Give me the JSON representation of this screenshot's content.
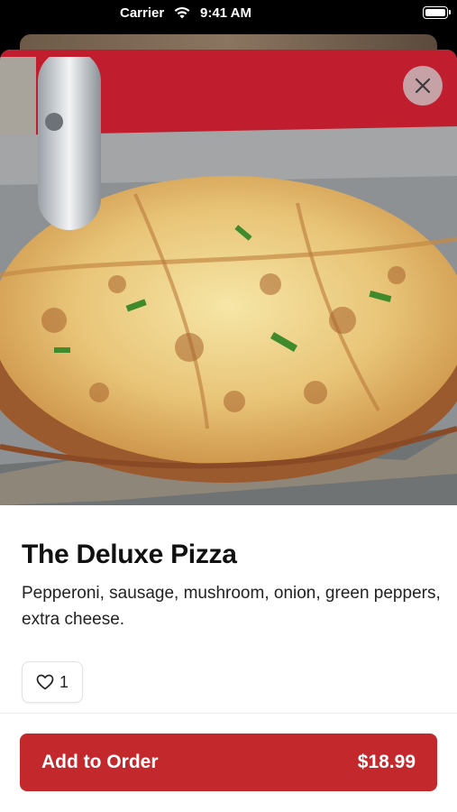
{
  "status_bar": {
    "carrier": "Carrier",
    "time": "9:41 AM"
  },
  "item": {
    "title": "The Deluxe Pizza",
    "description": "Pepperoni, sausage, mushroom, onion, green peppers, extra cheese.",
    "likes": "1",
    "image": "pizza-photo"
  },
  "footer": {
    "add_label": "Add to Order",
    "price": "$18.99"
  },
  "colors": {
    "accent": "#c2282c",
    "title_text": "#111111"
  },
  "icons": {
    "close": "close-icon",
    "like": "heart-icon",
    "wifi": "wifi-icon",
    "battery": "battery-icon"
  }
}
